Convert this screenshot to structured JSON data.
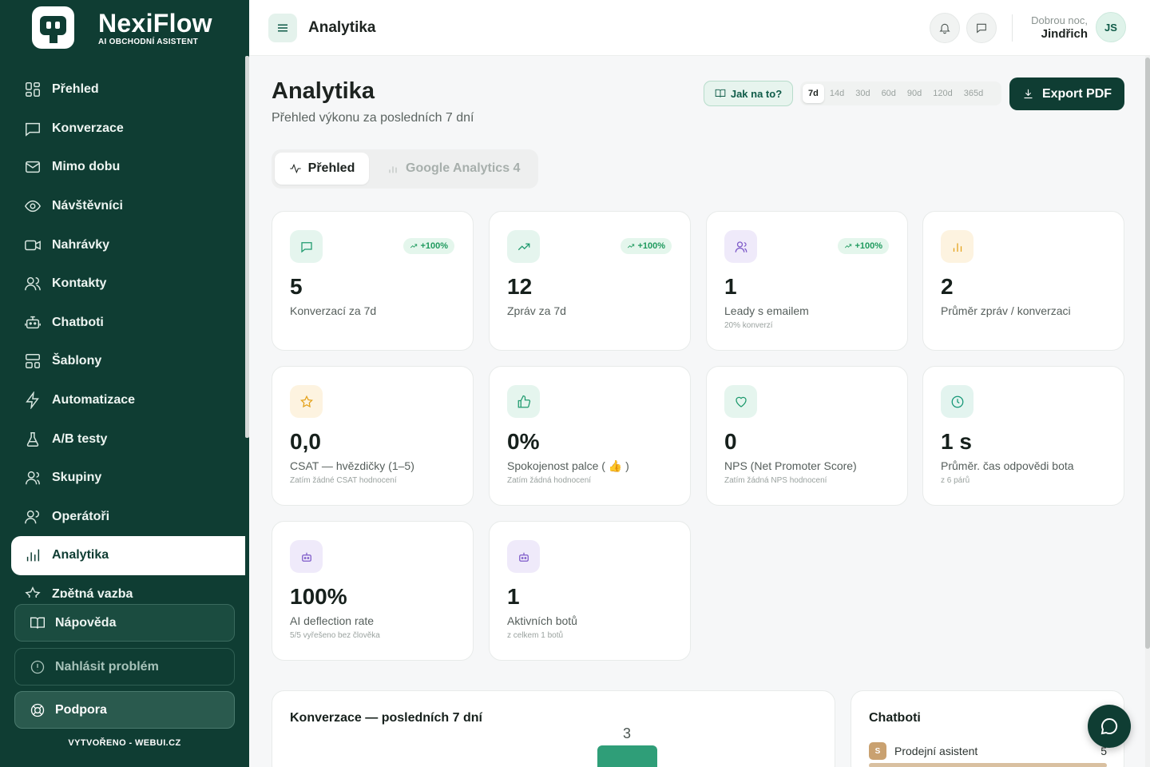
{
  "brand": {
    "name": "NexiFlow",
    "tagline": "AI OBCHODNÍ ASISTENT"
  },
  "sidebar": {
    "items": [
      {
        "label": "Přehled",
        "icon": "grid-icon"
      },
      {
        "label": "Konverzace",
        "icon": "chat-icon"
      },
      {
        "label": "Mimo dobu",
        "icon": "mail-icon"
      },
      {
        "label": "Návštěvníci",
        "icon": "eye-icon"
      },
      {
        "label": "Nahrávky",
        "icon": "video-icon"
      },
      {
        "label": "Kontakty",
        "icon": "contacts-icon"
      },
      {
        "label": "Chatboti",
        "icon": "bot-icon"
      },
      {
        "label": "Šablony",
        "icon": "template-icon"
      },
      {
        "label": "Automatizace",
        "icon": "bolt-icon"
      },
      {
        "label": "A/B testy",
        "icon": "flask-icon"
      },
      {
        "label": "Skupiny",
        "icon": "users-icon"
      },
      {
        "label": "Operátoři",
        "icon": "operators-icon"
      },
      {
        "label": "Analytika",
        "icon": "analytics-icon",
        "active": true
      },
      {
        "label": "Zpětná vazba",
        "icon": "star-icon"
      }
    ],
    "help_label": "Nápověda",
    "report_label": "Nahlásit problém",
    "support_label": "Podpora",
    "credit": "VYTVOŘENO - WEBUI.CZ"
  },
  "topbar": {
    "title": "Analytika",
    "greeting": "Dobrou noc,",
    "user_name": "Jindřich",
    "avatar_initials": "JS"
  },
  "page": {
    "title": "Analytika",
    "subtitle": "Přehled výkonu za posledních 7 dní",
    "howto_label": "Jak na to?",
    "ranges": [
      "7d",
      "14d",
      "30d",
      "60d",
      "90d",
      "120d",
      "365d"
    ],
    "selected_range": "7d",
    "export_label": "Export PDF",
    "tabs": [
      "Přehled",
      "Google Analytics 4"
    ],
    "active_tab": "Přehled"
  },
  "stats": [
    {
      "value": "5",
      "label": "Konverzací za 7d",
      "note": "",
      "badge": "+100%",
      "icon": "chat-icon",
      "tone": "green"
    },
    {
      "value": "12",
      "label": "Zpráv za 7d",
      "note": "",
      "badge": "+100%",
      "icon": "trend-up-icon",
      "tone": "green"
    },
    {
      "value": "1",
      "label": "Leady s emailem",
      "note": "20% konverzí",
      "badge": "+100%",
      "icon": "users-icon",
      "tone": "purple"
    },
    {
      "value": "2",
      "label": "Průměr zpráv / konverzaci",
      "note": "",
      "badge": "",
      "icon": "bar-chart-icon",
      "tone": "amber"
    },
    {
      "value": "0,0",
      "label": "CSAT — hvězdičky (1–5)",
      "note": "Zatím žádné CSAT hodnocení",
      "badge": "",
      "icon": "star-icon",
      "tone": "amber"
    },
    {
      "value": "0%",
      "label": "Spokojenost palce ( 👍 )",
      "note": "Zatím žádná hodnocení",
      "badge": "",
      "icon": "thumbs-up-icon",
      "tone": "green"
    },
    {
      "value": "0",
      "label": "NPS (Net Promoter Score)",
      "note": "Zatím žádná NPS hodnocení",
      "badge": "",
      "icon": "heart-icon",
      "tone": "green"
    },
    {
      "value": "1 s",
      "label": "Průměr. čas odpovědi bota",
      "note": "z 6 párů",
      "badge": "",
      "icon": "clock-icon",
      "tone": "teal"
    },
    {
      "value": "100%",
      "label": "AI deflection rate",
      "note": "5/5 vyřešeno bez člověka",
      "badge": "",
      "icon": "bot-icon",
      "tone": "purple"
    },
    {
      "value": "1",
      "label": "Aktivních botů",
      "note": "z celkem 1 botů",
      "badge": "",
      "icon": "bot-icon",
      "tone": "purple"
    }
  ],
  "conversations_chart": {
    "title": "Konverzace — posledních 7 dní",
    "bar_color": "#2f9e78",
    "peak_label": "3",
    "peak_value": 3
  },
  "bots_panel": {
    "title": "Chatboti",
    "bots": [
      {
        "badge": "S",
        "name": "Prodejní asistent",
        "count": "5"
      }
    ]
  }
}
